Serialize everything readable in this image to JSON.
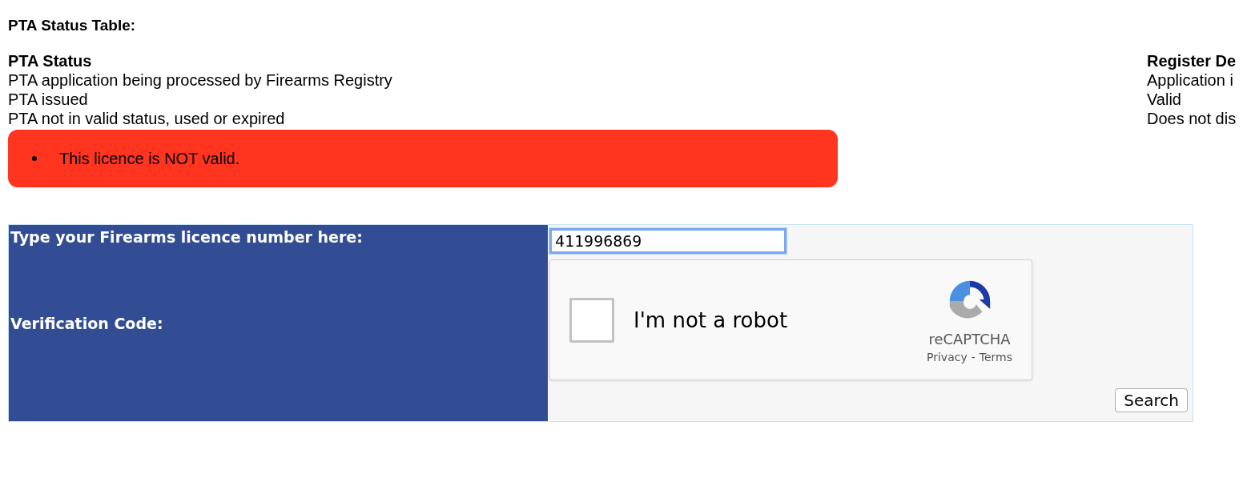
{
  "title": "PTA Status Table:",
  "status_table": {
    "columns": [
      {
        "heading": "PTA Status",
        "rows": [
          "PTA application being processed by Firearms Registry",
          "PTA issued",
          "PTA not in valid status, used or expired"
        ]
      },
      {
        "heading": "Register De",
        "rows": [
          "Application i",
          "Valid",
          "Does not dis"
        ]
      }
    ]
  },
  "alert": {
    "messages": [
      "This licence is NOT valid."
    ]
  },
  "form": {
    "licence_label": "Type your Firearms licence number here:",
    "licence_value": "411996869",
    "verification_label": "Verification Code:",
    "captcha": {
      "label": "I'm not a robot",
      "checked": false,
      "brand": "reCAPTCHA",
      "privacy": "Privacy",
      "separator": "-",
      "terms": "Terms"
    },
    "search_button": "Search"
  }
}
